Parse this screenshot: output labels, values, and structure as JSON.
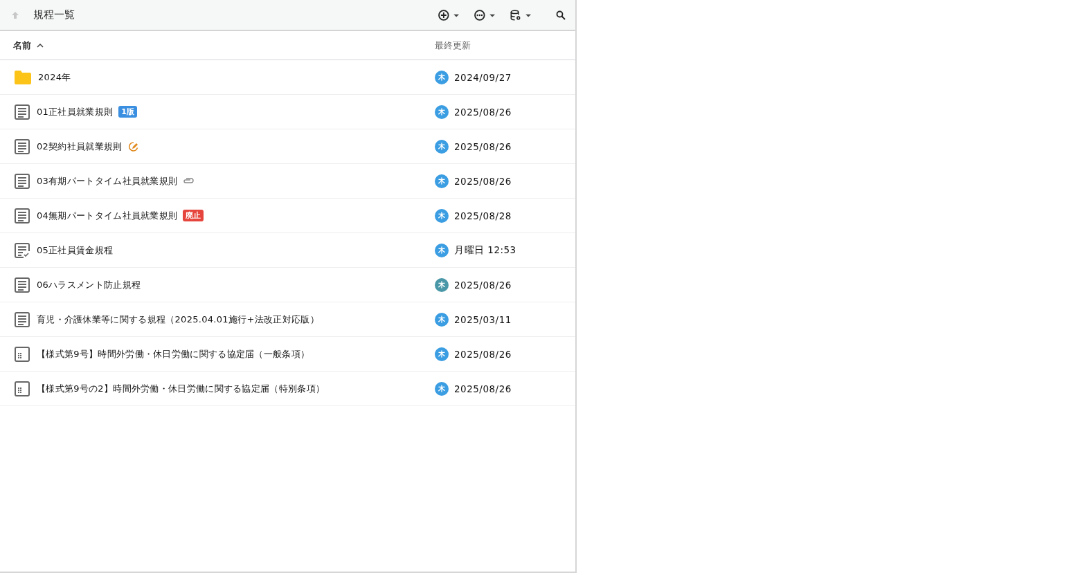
{
  "toolbar": {
    "title": "規程一覧"
  },
  "columns": [
    {
      "label": "名前",
      "sorted": true,
      "descending": false
    },
    {
      "label": "最終更新",
      "sorted": false
    }
  ],
  "rows": [
    {
      "kind": "folder",
      "name": "2024年",
      "avatar": "木",
      "color": "#3b9de2",
      "updated": "2024/09/27"
    },
    {
      "kind": "document",
      "name": "01正社員就業規則",
      "badge": {
        "kind": "version",
        "label": "1版"
      },
      "avatar": "木",
      "color": "#3b9de2",
      "updated": "2025/08/26"
    },
    {
      "kind": "document",
      "name": "02契約社員就業規則",
      "badge": {
        "kind": "editing"
      },
      "avatar": "木",
      "color": "#3b9de2",
      "updated": "2025/08/26"
    },
    {
      "kind": "document",
      "name": "03有期パートタイム社員就業規則",
      "badge": {
        "kind": "attachment"
      },
      "avatar": "木",
      "color": "#3b9de2",
      "updated": "2025/08/26"
    },
    {
      "kind": "document",
      "name": "04無期パートタイム社員就業規則",
      "badge": {
        "kind": "abolished",
        "label": "廃止"
      },
      "avatar": "木",
      "color": "#3b9de2",
      "updated": "2025/08/28"
    },
    {
      "kind": "checked-document",
      "name": "05正社員賃金規程",
      "avatar": "木",
      "color": "#3b9de2",
      "updated": "月曜日 12:53"
    },
    {
      "kind": "document",
      "name": "06ハラスメント防止規程",
      "avatar": "木",
      "color": "#4a97a8",
      "updated": "2025/08/26"
    },
    {
      "kind": "document",
      "name": "育児・介護休業等に関する規程（2025.04.01施行+法改正対応版）",
      "avatar": "木",
      "color": "#3b9de2",
      "updated": "2025/03/11"
    },
    {
      "kind": "form",
      "name": "【様式第9号】時間外労働・休日労働に関する協定届（一般条項）",
      "avatar": "木",
      "color": "#3b9de2",
      "updated": "2025/08/26"
    },
    {
      "kind": "form",
      "name": "【様式第9号の2】時間外労働・休日労働に関する協定届（特別条項）",
      "avatar": "木",
      "color": "#3b9de2",
      "updated": "2025/08/26"
    }
  ]
}
